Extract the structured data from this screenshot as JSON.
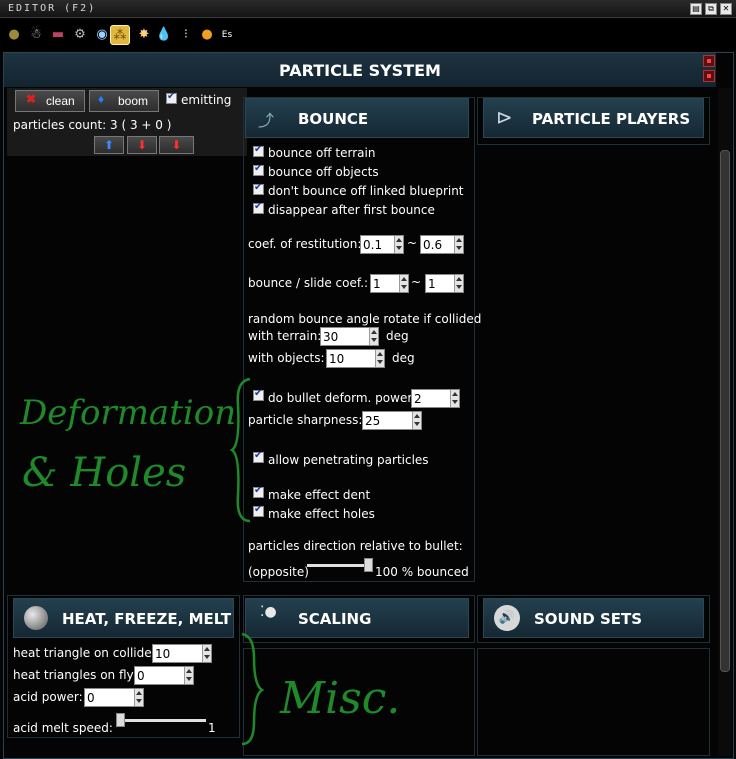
{
  "window": {
    "title": "EDITOR (F2)"
  },
  "toolbar": {
    "icons": [
      "planet-icon",
      "robot-icon",
      "vehicle-icon",
      "gear-icon",
      "radar-icon",
      "particles-icon",
      "explosion-icon",
      "water-drop-icon",
      "bones-icon",
      "orb-icon",
      "escape-icon"
    ],
    "escape_label": "Es"
  },
  "panel": {
    "title": "PARTICLE SYSTEM"
  },
  "emitter": {
    "clean_label": "clean",
    "boom_label": "boom",
    "emitting_label": "emitting",
    "particles_count": "particles count: 3 ( 3 + 0 )"
  },
  "sections": {
    "bounce": "BOUNCE",
    "particle_players": "PARTICLE PLAYERS",
    "heat": "HEAT, FREEZE, MELT",
    "scaling": "SCALING",
    "sound_sets": "SOUND SETS"
  },
  "bounce": {
    "off_terrain": "bounce off terrain",
    "off_objects": "bounce off objects",
    "no_linked": "don't bounce off linked blueprint",
    "disappear": "disappear after first bounce",
    "restitution_label": "coef. of restitution:",
    "restitution_min": "0.1",
    "restitution_max": "0.6",
    "tilde": "~",
    "slide_label": "bounce / slide coef.:",
    "slide_min": "1",
    "slide_max": "1",
    "random_label": "random bounce angle rotate if collided",
    "with_terrain_label": "with terrain:",
    "with_terrain_value": "30",
    "with_objects_label": "with objects:",
    "with_objects_value": "10",
    "deg": "deg",
    "deform_label": "do bullet deform. power:",
    "deform_value": "2",
    "sharpness_label": "particle sharpness:",
    "sharpness_value": "25",
    "penetrating_label": "allow penetrating particles",
    "dent_label": "make effect dent",
    "holes_label": "make effect holes",
    "direction_label": "particles direction relative to bullet:",
    "opposite_label": "(opposite)",
    "bounced_label": "100 % bounced",
    "bounced_fraction": 1.0
  },
  "heat": {
    "collide_label": "heat triangle on collide:",
    "collide_value": "10",
    "fly_label": "heat triangles on fly:",
    "fly_value": "0",
    "acid_power_label": "acid power:",
    "acid_power_value": "0",
    "acid_melt_label": "acid melt speed:",
    "acid_melt_value": "1",
    "acid_melt_fraction": 0.0
  },
  "annotations": {
    "deformation": "Deformation",
    "holes": "& Holes",
    "misc": "Misc."
  },
  "colors": {
    "accent_header": "#1e3340",
    "handwriting": "#1f8a2a",
    "check": "#1a3aa0"
  }
}
